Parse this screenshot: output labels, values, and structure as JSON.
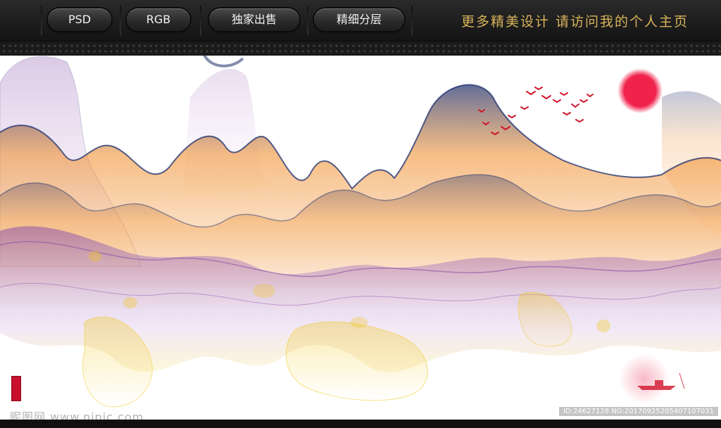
{
  "toolbar": {
    "buttons": [
      {
        "label": "PSD"
      },
      {
        "label": "RGB"
      },
      {
        "label": "独家出售"
      },
      {
        "label": "精细分层"
      }
    ],
    "tagline": "更多精美设计  请访问我的个人主页"
  },
  "watermark": {
    "site": "昵图网 www.nipic.com",
    "id": "ID:24627128 NO:20170925205407107031"
  },
  "colors": {
    "bar_bg": "#1c1c1c",
    "tagline": "#d9b45b",
    "sun": "#f0234d",
    "birds": "#d0142a",
    "smoke_orange": "#f08a24",
    "smoke_purple": "#8a4fa8",
    "smoke_navy": "#1e2f6e",
    "smoke_yellow": "#f2c81e"
  }
}
